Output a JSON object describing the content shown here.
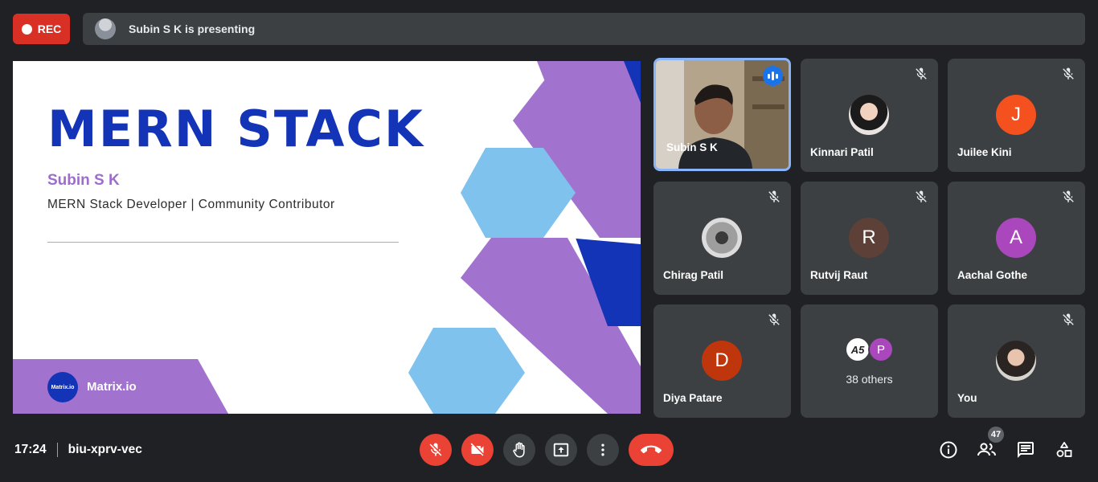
{
  "recording": {
    "label": "REC"
  },
  "presenting": {
    "text": "Subin S K is presenting"
  },
  "slide": {
    "title": "MERN STACK",
    "name": "Subin S K",
    "role": "MERN Stack Developer | Community Contributor",
    "brand_name": "Matrix.io",
    "brand_logo_text": "Matrix.io",
    "colors": {
      "title": "#1434b8",
      "purple": "#a173cf",
      "light_blue": "#7fc2ee",
      "dark_blue": "#1434b8"
    }
  },
  "participants": [
    {
      "name": "Subin S K",
      "kind": "video",
      "speaking": true
    },
    {
      "name": "Kinnari Patil",
      "kind": "photo",
      "muted": true
    },
    {
      "name": "Juilee Kini",
      "initial": "J",
      "color": "#f4511e",
      "muted": true
    },
    {
      "name": "Chirag Patil",
      "kind": "photo",
      "muted": true
    },
    {
      "name": "Rutvij Raut",
      "initial": "R",
      "color": "#5d4037",
      "muted": true
    },
    {
      "name": "Aachal Gothe",
      "initial": "A",
      "color": "#ab47bc",
      "muted": true
    },
    {
      "name": "Diya Patare",
      "initial": "D",
      "color": "#bf360c",
      "muted": true
    },
    {
      "name": "You",
      "kind": "photo",
      "muted": true
    }
  ],
  "others": {
    "label": "38 others",
    "initial": "P",
    "color": "#ab47bc"
  },
  "bottom": {
    "time": "17:24",
    "meeting_code": "biu-xprv-vec",
    "people_count": "47"
  },
  "icons": [
    "mic-off-icon",
    "camera-off-icon",
    "raise-hand-icon",
    "present-icon",
    "more-icon",
    "end-call-icon",
    "info-icon",
    "people-icon",
    "chat-icon",
    "activities-icon"
  ]
}
